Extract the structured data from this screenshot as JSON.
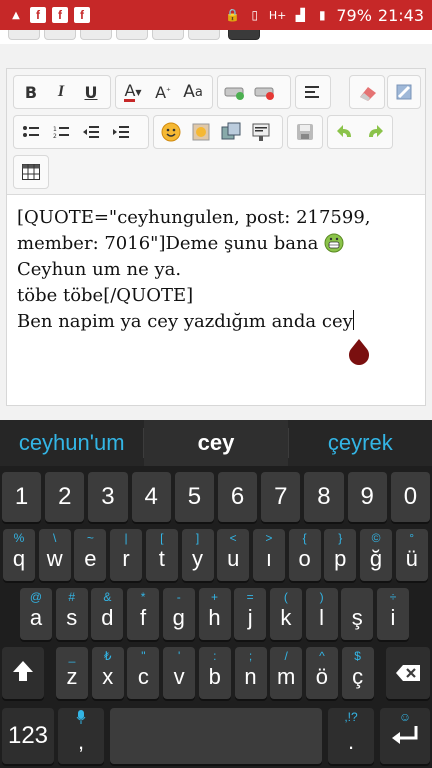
{
  "status_bar": {
    "icons": [
      "facebook-icon",
      "facebook-icon",
      "facebook-icon"
    ],
    "battery": "79%",
    "time": "21:43"
  },
  "editor": {
    "toolbar": {
      "bold": "B",
      "italic": "I",
      "underline": "U",
      "font_color": "A",
      "font_size": "A",
      "remove_format": "a"
    },
    "content_lines": [
      "[QUOTE=\"ceyhungulen, post: 217599,",
      "member: 7016\"]Deme şunu bana",
      "Ceyhun um ne ya.",
      "töbe töbe[/QUOTE]",
      "Ben napim ya cey yazdığım anda cey"
    ]
  },
  "keyboard": {
    "suggestions": [
      "ceyhun'um",
      "cey",
      "çeyrek"
    ],
    "numbers": [
      "1",
      "2",
      "3",
      "4",
      "5",
      "6",
      "7",
      "8",
      "9",
      "0"
    ],
    "row1": [
      {
        "k": "q",
        "a": "%"
      },
      {
        "k": "w",
        "a": "\\"
      },
      {
        "k": "e",
        "a": "~"
      },
      {
        "k": "r",
        "a": "|"
      },
      {
        "k": "t",
        "a": "["
      },
      {
        "k": "y",
        "a": "]"
      },
      {
        "k": "u",
        "a": "<"
      },
      {
        "k": "ı",
        "a": ">"
      },
      {
        "k": "o",
        "a": "{"
      },
      {
        "k": "p",
        "a": "}"
      },
      {
        "k": "ğ",
        "a": "©"
      },
      {
        "k": "ü",
        "a": "°"
      }
    ],
    "row2": [
      {
        "k": "a",
        "a": "@"
      },
      {
        "k": "s",
        "a": "#"
      },
      {
        "k": "d",
        "a": "&"
      },
      {
        "k": "f",
        "a": "*"
      },
      {
        "k": "g",
        "a": "-"
      },
      {
        "k": "h",
        "a": "+"
      },
      {
        "k": "j",
        "a": "="
      },
      {
        "k": "k",
        "a": "("
      },
      {
        "k": "l",
        "a": ")"
      },
      {
        "k": "ş",
        "a": ""
      },
      {
        "k": "i",
        "a": "÷"
      }
    ],
    "row3": [
      {
        "k": "z",
        "a": "_"
      },
      {
        "k": "x",
        "a": "₺"
      },
      {
        "k": "c",
        "a": "\""
      },
      {
        "k": "v",
        "a": "'"
      },
      {
        "k": "b",
        "a": ":"
      },
      {
        "k": "n",
        "a": ";"
      },
      {
        "k": "m",
        "a": "/"
      },
      {
        "k": "ö",
        "a": "^"
      },
      {
        "k": "ç",
        "a": "$"
      }
    ],
    "mode_key": "123",
    "comma": ",",
    "period": ".",
    "punct_alt": ",!?"
  },
  "colors": {
    "status_bar": "#c62828",
    "accent": "#33b5e5"
  }
}
